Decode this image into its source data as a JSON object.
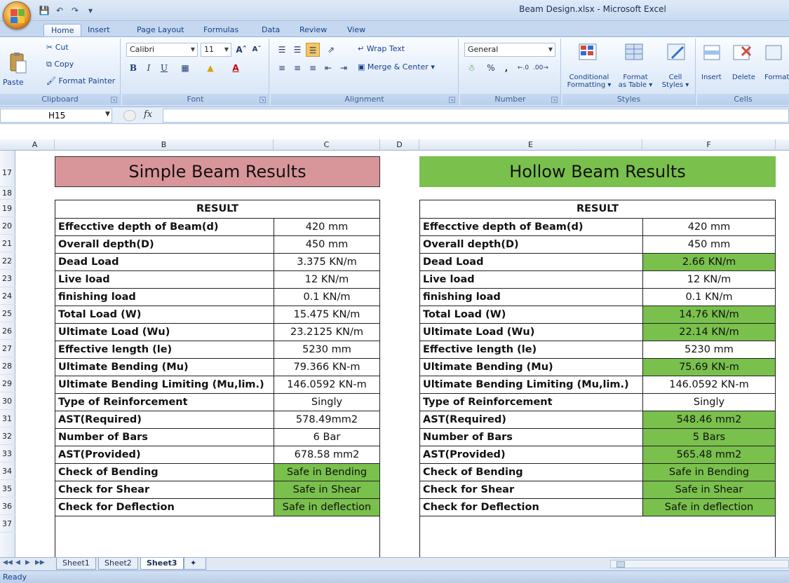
{
  "window": {
    "title": "Beam Design.xlsx - Microsoft Excel"
  },
  "tabs": [
    "Home",
    "Insert",
    "Page Layout",
    "Formulas",
    "Data",
    "Review",
    "View"
  ],
  "ribbon": {
    "clipboard": {
      "paste": "Paste",
      "cut": "Cut",
      "copy": "Copy",
      "format_painter": "Format Painter",
      "label": "Clipboard"
    },
    "font": {
      "name": "Calibri",
      "size": "11",
      "label": "Font"
    },
    "alignment": {
      "wrap_text": "Wrap Text",
      "merge_center": "Merge & Center",
      "label": "Alignment"
    },
    "number": {
      "format": "General",
      "percent": "%",
      "comma": ",",
      "label": "Number"
    },
    "styles": {
      "conditional": "Conditional",
      "conditional2": "Formatting",
      "format_as": "Format",
      "format_as2": "as Table",
      "cell": "Cell",
      "cell2": "Styles",
      "label": "Styles"
    },
    "cells": {
      "insert": "Insert",
      "delete": "Delete",
      "format": "Format",
      "label": "Cells"
    }
  },
  "formula_bar": {
    "name_box": "H15",
    "fx": "fx",
    "value": ""
  },
  "columns": [
    "A",
    "B",
    "C",
    "D",
    "E",
    "F"
  ],
  "rows": [
    "17",
    "18",
    "19",
    "20",
    "21",
    "22",
    "23",
    "24",
    "25",
    "26",
    "27",
    "28",
    "29",
    "30",
    "31",
    "32",
    "33",
    "34",
    "35",
    "36",
    "37"
  ],
  "simple": {
    "title": "Simple Beam Results",
    "header": "RESULT",
    "rows": [
      {
        "label": "Effecctive depth of Beam(d)",
        "value": "420 mm",
        "green": false
      },
      {
        "label": "Overall depth(D)",
        "value": "450 mm",
        "green": false
      },
      {
        "label": "Dead Load",
        "value": "3.375 KN/m",
        "green": false
      },
      {
        "label": "Live load",
        "value": "12 KN/m",
        "green": false
      },
      {
        "label": "finishing load",
        "value": "0.1 KN/m",
        "green": false
      },
      {
        "label": "Total Load (W)",
        "value": "15.475 KN/m",
        "green": false
      },
      {
        "label": "Ultimate Load (Wu)",
        "value": "23.2125 KN/m",
        "green": false
      },
      {
        "label": "Effective length (le)",
        "value": "5230 mm",
        "green": false
      },
      {
        "label": "Ultimate Bending (Mu)",
        "value": "79.366 KN-m",
        "green": false
      },
      {
        "label": "Ultimate Bending Limiting (Mu,lim.)",
        "value": "146.0592 KN-m",
        "green": false
      },
      {
        "label": "Type of Reinforcement",
        "value": "Singly",
        "green": false
      },
      {
        "label": "AST(Required)",
        "value": "578.49mm2",
        "green": false
      },
      {
        "label": "Number of Bars",
        "value": "6 Bar",
        "green": false
      },
      {
        "label": "AST(Provided)",
        "value": "678.58 mm2",
        "green": false
      },
      {
        "label": "Check of Bending",
        "value": "Safe in Bending",
        "green": true
      },
      {
        "label": "Check for Shear",
        "value": "Safe in Shear",
        "green": true
      },
      {
        "label": "Check for Deflection",
        "value": "Safe in deflection",
        "green": true
      }
    ]
  },
  "hollow": {
    "title": "Hollow Beam Results",
    "header": "RESULT",
    "rows": [
      {
        "label": "Effecctive depth of Beam(d)",
        "value": "420 mm",
        "green": false
      },
      {
        "label": "Overall depth(D)",
        "value": "450 mm",
        "green": false
      },
      {
        "label": "Dead Load",
        "value": "2.66 KN/m",
        "green": true
      },
      {
        "label": "Live load",
        "value": "12 KN/m",
        "green": false
      },
      {
        "label": "finishing load",
        "value": "0.1 KN/m",
        "green": false
      },
      {
        "label": "Total Load (W)",
        "value": "14.76 KN/m",
        "green": true
      },
      {
        "label": "Ultimate Load (Wu)",
        "value": "22.14 KN/m",
        "green": true
      },
      {
        "label": "Effective length (le)",
        "value": "5230 mm",
        "green": false
      },
      {
        "label": "Ultimate Bending (Mu)",
        "value": "75.69 KN-m",
        "green": true
      },
      {
        "label": "Ultimate Bending Limiting (Mu,lim.)",
        "value": "146.0592 KN-m",
        "green": false
      },
      {
        "label": "Type of Reinforcement",
        "value": "Singly",
        "green": false
      },
      {
        "label": "AST(Required)",
        "value": "548.46 mm2",
        "green": true
      },
      {
        "label": "Number of Bars",
        "value": "5 Bars",
        "green": true
      },
      {
        "label": "AST(Provided)",
        "value": "565.48 mm2",
        "green": true
      },
      {
        "label": "Check of Bending",
        "value": "Safe in Bending",
        "green": true
      },
      {
        "label": "Check for Shear",
        "value": "Safe in Shear",
        "green": true
      },
      {
        "label": "Check for Deflection",
        "value": "Safe in deflection",
        "green": true
      }
    ]
  },
  "sheets": [
    "Sheet1",
    "Sheet2",
    "Sheet3"
  ],
  "active_sheet": "Sheet3",
  "status": "Ready",
  "colors": {
    "simple_banner": "#d9969a",
    "hollow_banner": "#79c04c",
    "green_cell": "#79c04c"
  }
}
